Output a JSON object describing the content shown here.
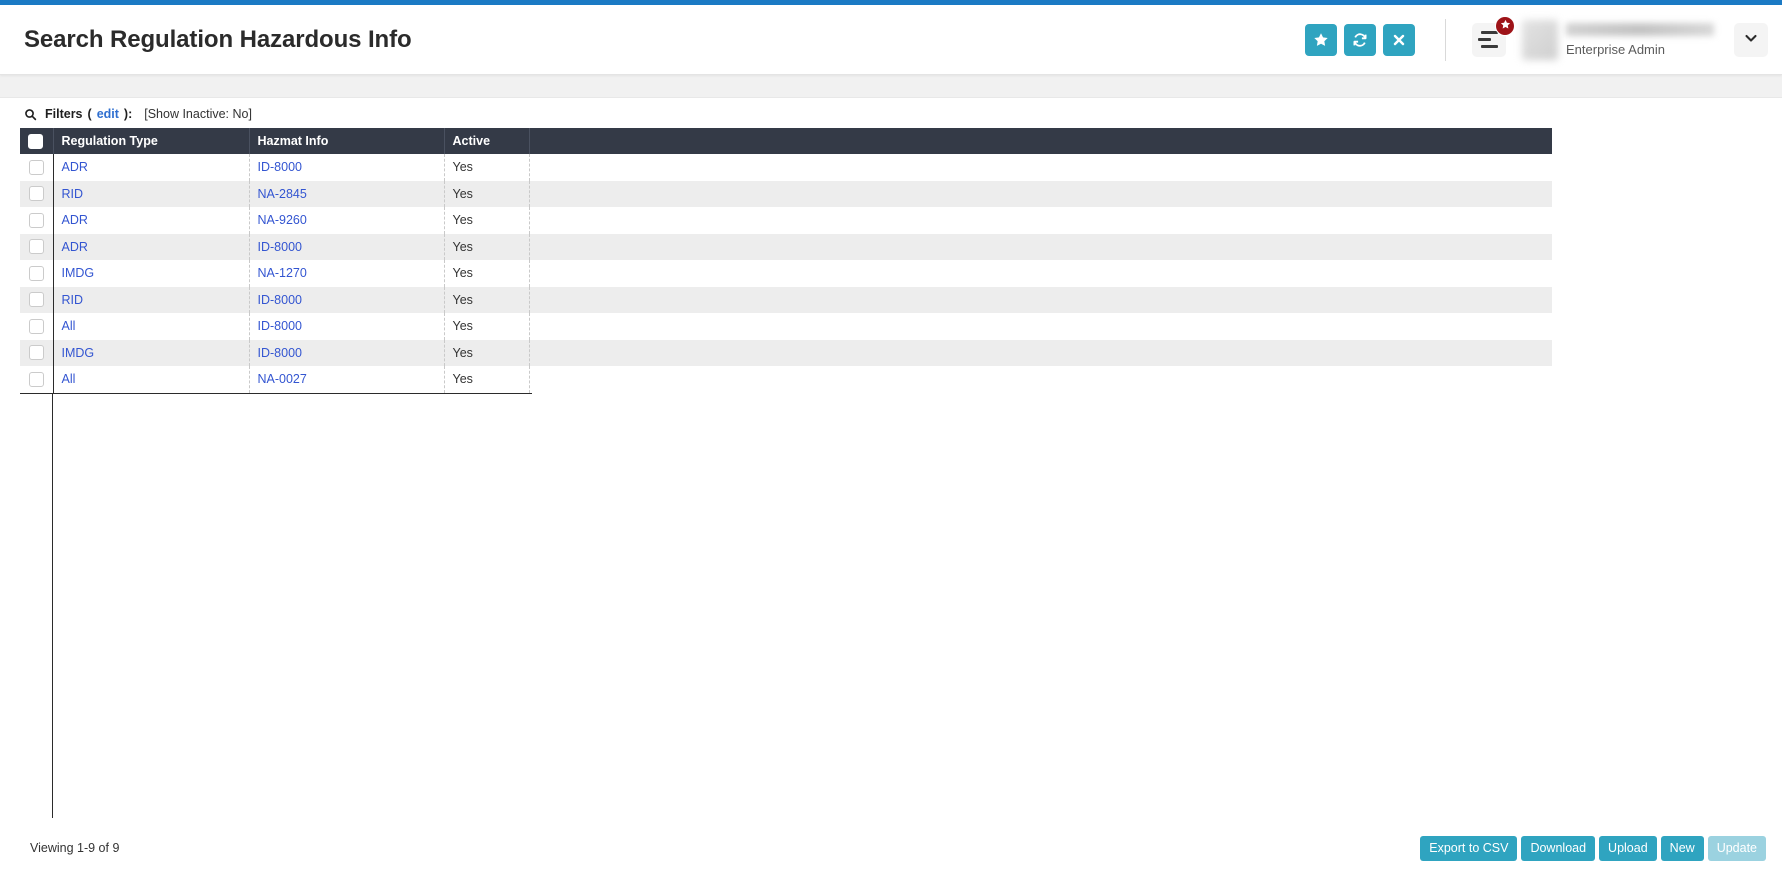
{
  "header": {
    "title": "Search Regulation Hazardous Info",
    "actions": [
      {
        "name": "favorite",
        "icon": "star-icon",
        "label": "Favorite"
      },
      {
        "name": "refresh",
        "icon": "refresh-icon",
        "label": "Refresh"
      },
      {
        "name": "close",
        "icon": "close-icon",
        "label": "Close"
      }
    ],
    "menu": {
      "icon": "hamburger-menu-icon",
      "badge_icon": "star-icon"
    },
    "user": {
      "name": "",
      "role": "Enterprise Admin"
    },
    "chevron": "chevron-down-icon",
    "accent_color": "#2fa4c0",
    "top_bar_color": "#1b7ac4",
    "badge_color": "#9e1318"
  },
  "filters": {
    "icon": "search-icon",
    "label": "Filters",
    "edit_label": "edit",
    "punct_open": "(",
    "punct_close": "):",
    "state": "[Show Inactive: No]"
  },
  "table": {
    "columns": [
      "Regulation Type",
      "Hazmat Info",
      "Active"
    ],
    "header_bg": "#343a47",
    "rows": [
      {
        "regulation_type": "ADR",
        "hazmat_info": "ID-8000",
        "active": "Yes"
      },
      {
        "regulation_type": "RID",
        "hazmat_info": "NA-2845",
        "active": "Yes"
      },
      {
        "regulation_type": "ADR",
        "hazmat_info": "NA-9260",
        "active": "Yes"
      },
      {
        "regulation_type": "ADR",
        "hazmat_info": "ID-8000",
        "active": "Yes"
      },
      {
        "regulation_type": "IMDG",
        "hazmat_info": "NA-1270",
        "active": "Yes"
      },
      {
        "regulation_type": "RID",
        "hazmat_info": "ID-8000",
        "active": "Yes"
      },
      {
        "regulation_type": "All",
        "hazmat_info": "ID-8000",
        "active": "Yes"
      },
      {
        "regulation_type": "IMDG",
        "hazmat_info": "ID-8000",
        "active": "Yes"
      },
      {
        "regulation_type": "All",
        "hazmat_info": "NA-0027",
        "active": "Yes"
      }
    ]
  },
  "footer": {
    "viewing": "Viewing 1-9 of 9",
    "buttons": [
      {
        "label": "Export to CSV",
        "disabled": false
      },
      {
        "label": "Download",
        "disabled": false
      },
      {
        "label": "Upload",
        "disabled": false
      },
      {
        "label": "New",
        "disabled": false
      },
      {
        "label": "Update",
        "disabled": true
      }
    ]
  }
}
